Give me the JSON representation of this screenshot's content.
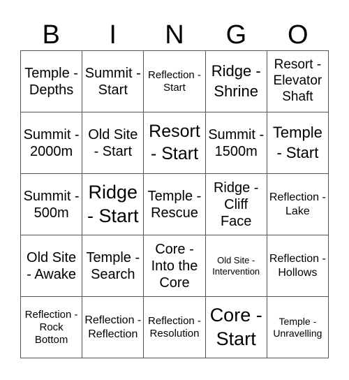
{
  "header": {
    "letters": [
      "B",
      "I",
      "N",
      "G",
      "O"
    ]
  },
  "cells": [
    [
      "Temple - Depths",
      "Summit - Start",
      "Reflection - Start",
      "Ridge - Shrine",
      "Resort - Elevator Shaft"
    ],
    [
      "Summit - 2000m",
      "Old Site - Start",
      "Resort - Start",
      "Summit - 1500m",
      "Temple - Start"
    ],
    [
      "Summit - 500m",
      "Ridge - Start",
      "Temple - Rescue",
      "Ridge - Cliff Face",
      "Reflection - Lake"
    ],
    [
      "Old Site - Awake",
      "Temple - Search",
      "Core - Into the Core",
      "Old Site - Intervention",
      "Reflection - Hollows"
    ],
    [
      "Reflection - Rock Bottom",
      "Reflection - Reflection",
      "Reflection - Resolution",
      "Core - Start",
      "Temple - Unravelling"
    ]
  ]
}
